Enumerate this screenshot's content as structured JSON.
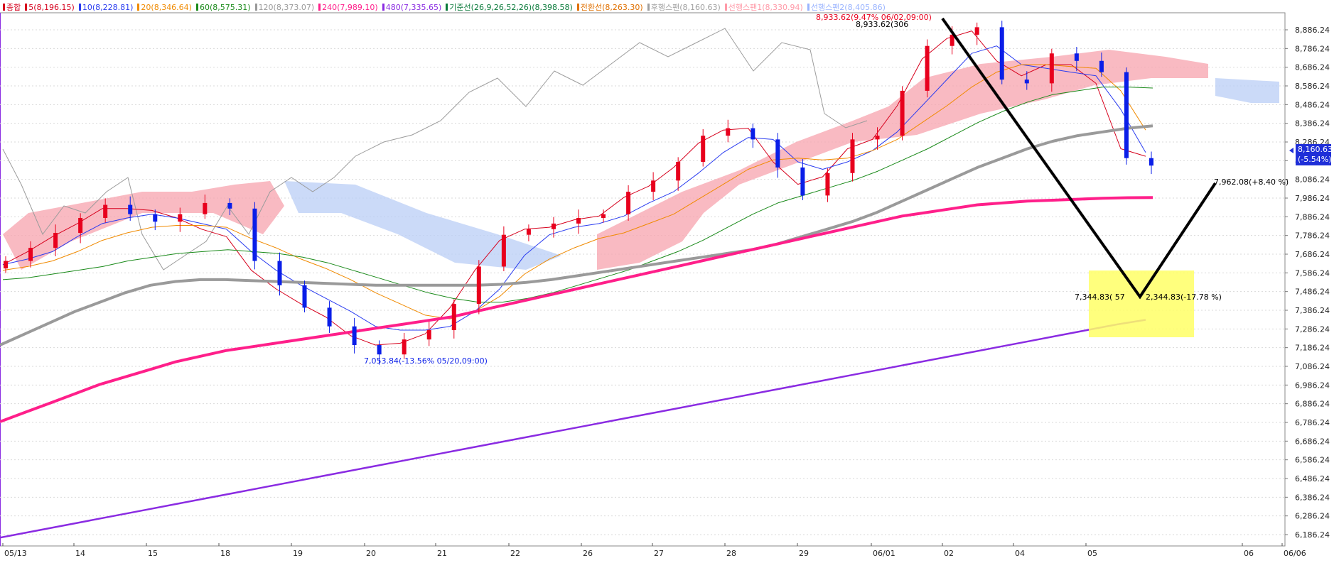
{
  "legend": [
    {
      "label": "종합",
      "color": "#d6001c"
    },
    {
      "label": "5(8,196.15)",
      "color": "#d6001c"
    },
    {
      "label": "10(8,228.81)",
      "color": "#2a3cf0"
    },
    {
      "label": "20(8,346.64)",
      "color": "#f08a00"
    },
    {
      "label": "60(8,575.31)",
      "color": "#1a8a1a"
    },
    {
      "label": "120(8,373.07)",
      "color": "#9a9a9a"
    },
    {
      "label": "240(7,989.10)",
      "color": "#ff1f8a"
    },
    {
      "label": "480(7,335.65)",
      "color": "#8a2be2"
    },
    {
      "label": "기준선(26,9,26,52,26)(8,398.58)",
      "color": "#0a7a3a"
    },
    {
      "label": "전환선(8,263.30)",
      "color": "#e07000"
    },
    {
      "label": "후행스팬(8,160.63)",
      "color": "#a0a0a0"
    },
    {
      "label": "선행스팬1(8,330.94)",
      "color": "#ff9aa8"
    },
    {
      "label": "선행스팬2(8,405.86)",
      "color": "#9ab4ff"
    }
  ],
  "chart_data": {
    "type": "candlestick",
    "ylim": [
      6136.24,
      9000
    ],
    "yticks": [
      "8,886.24",
      "8,786.24",
      "8,686.24",
      "8,586.24",
      "8,486.24",
      "8,386.24",
      "8,286.24",
      "8,186.24",
      "8,086.24",
      "7,986.24",
      "7,886.24",
      "7,786.24",
      "7,686.24",
      "7,586.24",
      "7,486.24",
      "7,386.24",
      "7,286.24",
      "7,186.24",
      "7,086.24",
      "6,986.24",
      "6,886.24",
      "6,786.24",
      "6,686.24",
      "6,586.24",
      "6,486.24",
      "6,386.24",
      "6,286.24",
      "6,186.24"
    ],
    "xticks": [
      "05/13",
      "14",
      "15",
      "18",
      "19",
      "20",
      "21",
      "22",
      "26",
      "27",
      "28",
      "29",
      "06/01",
      "02",
      "04",
      "05",
      "06",
      "06/06"
    ],
    "current_price": "8,160.63",
    "current_change": "(-5.54%)",
    "annotations": {
      "high_label": "8,933.62(9.47% 06/02,09:00)",
      "high_point_label": "8,933.62(306",
      "low_label": "7,053.84(-13.56% 05/20,09:00)",
      "target_low_left": "7,344.83( 57",
      "target_low_right": "2,344.83(-17.78 %)",
      "target_high": "7,962.08(+8.40 %)"
    },
    "series": [
      {
        "name": "5",
        "values": [
          7630,
          7700,
          7780,
          7850,
          7930,
          7930,
          7920,
          7880,
          7820,
          7780,
          7600,
          7500,
          7420,
          7350,
          7250,
          7200,
          7210,
          7260,
          7400,
          7600,
          7760,
          7820,
          7830,
          7870,
          7890,
          7990,
          8050,
          8150,
          8280,
          8350,
          8360,
          8180,
          8060,
          8100,
          8250,
          8300,
          8480,
          8730,
          8840,
          8880,
          8720,
          8640,
          8700,
          8700,
          8600,
          8250,
          8210
        ]
      },
      {
        "name": "10",
        "values": [
          7630,
          7660,
          7700,
          7780,
          7850,
          7880,
          7900,
          7880,
          7850,
          7820,
          7700,
          7600,
          7520,
          7450,
          7380,
          7300,
          7280,
          7280,
          7300,
          7380,
          7500,
          7680,
          7790,
          7830,
          7850,
          7890,
          7960,
          8020,
          8120,
          8230,
          8310,
          8300,
          8180,
          8140,
          8180,
          8240,
          8340,
          8480,
          8620,
          8760,
          8800,
          8700,
          8680,
          8660,
          8640,
          8460,
          8230
        ]
      },
      {
        "name": "20",
        "values": [
          7600,
          7620,
          7650,
          7700,
          7760,
          7800,
          7830,
          7840,
          7840,
          7830,
          7770,
          7720,
          7660,
          7610,
          7550,
          7480,
          7420,
          7360,
          7340,
          7380,
          7460,
          7580,
          7660,
          7720,
          7770,
          7800,
          7850,
          7900,
          7980,
          8060,
          8140,
          8190,
          8200,
          8190,
          8200,
          8240,
          8300,
          8390,
          8480,
          8580,
          8660,
          8700,
          8700,
          8690,
          8680,
          8560,
          8350
        ]
      },
      {
        "name": "60",
        "values": [
          7550,
          7560,
          7580,
          7600,
          7620,
          7650,
          7670,
          7690,
          7700,
          7710,
          7700,
          7690,
          7670,
          7640,
          7600,
          7560,
          7520,
          7480,
          7450,
          7430,
          7430,
          7450,
          7480,
          7520,
          7560,
          7600,
          7650,
          7700,
          7760,
          7830,
          7900,
          7960,
          8000,
          8040,
          8080,
          8130,
          8190,
          8250,
          8320,
          8390,
          8450,
          8500,
          8540,
          8560,
          8580,
          8580,
          8575
        ]
      },
      {
        "name": "120",
        "values": [
          7200,
          7260,
          7320,
          7380,
          7430,
          7480,
          7520,
          7540,
          7550,
          7550,
          7545,
          7540,
          7535,
          7530,
          7525,
          7520,
          7520,
          7520,
          7520,
          7520,
          7525,
          7535,
          7550,
          7570,
          7590,
          7610,
          7630,
          7650,
          7670,
          7690,
          7710,
          7740,
          7780,
          7820,
          7860,
          7910,
          7970,
          8030,
          8090,
          8150,
          8200,
          8250,
          8290,
          8320,
          8340,
          8360,
          8373
        ]
      },
      {
        "name": "240",
        "values": [
          6790,
          6840,
          6890,
          6940,
          6990,
          7030,
          7070,
          7110,
          7140,
          7170,
          7190,
          7210,
          7230,
          7250,
          7270,
          7290,
          7310,
          7330,
          7350,
          7380,
          7410,
          7440,
          7470,
          7500,
          7530,
          7560,
          7590,
          7620,
          7650,
          7680,
          7710,
          7740,
          7770,
          7800,
          7830,
          7860,
          7890,
          7910,
          7930,
          7950,
          7960,
          7970,
          7975,
          7980,
          7985,
          7988,
          7989
        ]
      },
      {
        "name": "480",
        "values": [
          6170,
          6200,
          6230,
          6260,
          6290,
          6320,
          6350,
          6380,
          6410,
          6440,
          6470,
          6500,
          6530,
          6560,
          6590,
          6620,
          6650,
          6680,
          6710,
          6740,
          6770,
          6800,
          6830,
          6860,
          6890,
          6920,
          6950,
          6980,
          7010,
          7040,
          7070,
          7100,
          7130,
          7160,
          7190,
          7220,
          7250,
          7280,
          7310,
          7335
        ]
      }
    ],
    "candles_close": [
      7650,
      7720,
      7800,
      7880,
      7950,
      7900,
      7860,
      7900,
      7960,
      7930,
      7650,
      7520,
      7400,
      7300,
      7200,
      7150,
      7230,
      7280,
      7420,
      7620,
      7790,
      7820,
      7850,
      7880,
      7900,
      8020,
      8080,
      8180,
      8320,
      8360,
      8300,
      8150,
      8000,
      8120,
      8300,
      8320,
      8560,
      8800,
      8860,
      8900,
      8620,
      8600,
      8760,
      8720,
      8660,
      8200,
      8160
    ]
  }
}
